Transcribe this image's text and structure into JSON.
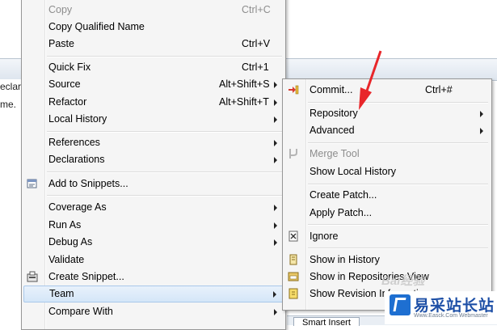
{
  "background": {
    "left_tab_line1": "eclara",
    "left_tab_line2": "me.",
    "bottom_tab": "Smart Insert"
  },
  "main_menu": {
    "items": [
      {
        "label": "Copy",
        "shortcut": "Ctrl+C",
        "disabled": true
      },
      {
        "label": "Copy Qualified Name"
      },
      {
        "label": "Paste",
        "shortcut": "Ctrl+V"
      },
      {
        "label": "Quick Fix",
        "shortcut": "Ctrl+1"
      },
      {
        "label": "Source",
        "shortcut": "Alt+Shift+S"
      },
      {
        "label": "Refactor",
        "shortcut": "Alt+Shift+T"
      },
      {
        "label": "Local History"
      },
      {
        "label": "References"
      },
      {
        "label": "Declarations"
      },
      {
        "label": "Add to Snippets...",
        "icon": "snippet-icon"
      },
      {
        "label": "Coverage As"
      },
      {
        "label": "Run As"
      },
      {
        "label": "Debug As"
      },
      {
        "label": "Validate"
      },
      {
        "label": "Create Snippet...",
        "icon": "create-snippet-icon"
      },
      {
        "label": "Team"
      },
      {
        "label": "Compare With"
      }
    ]
  },
  "team_menu": {
    "items": [
      {
        "label": "Commit...",
        "shortcut": "Ctrl+#",
        "icon": "commit-icon"
      },
      {
        "label": "Repository"
      },
      {
        "label": "Advanced"
      },
      {
        "label": "Merge Tool",
        "disabled": true,
        "icon": "merge-tool-icon"
      },
      {
        "label": "Show Local History"
      },
      {
        "label": "Create Patch..."
      },
      {
        "label": "Apply Patch..."
      },
      {
        "label": "Ignore",
        "icon": "ignore-icon"
      },
      {
        "label": "Show in History",
        "icon": "history-icon"
      },
      {
        "label": "Show in Repositories View",
        "icon": "git-repo-icon"
      },
      {
        "label": "Show Revision Information",
        "icon": "revision-icon"
      }
    ]
  },
  "watermark": {
    "brand": "易采站长站",
    "sub": "Www.Easck.Com  Webmaster",
    "baidu": "Bai经验"
  },
  "colors": {
    "annotation_arrow": "#e8262a",
    "menu_bg": "#f5f5f5",
    "hover_bg": "#d4e6f8",
    "watermark_blue": "#1d4fa6"
  }
}
